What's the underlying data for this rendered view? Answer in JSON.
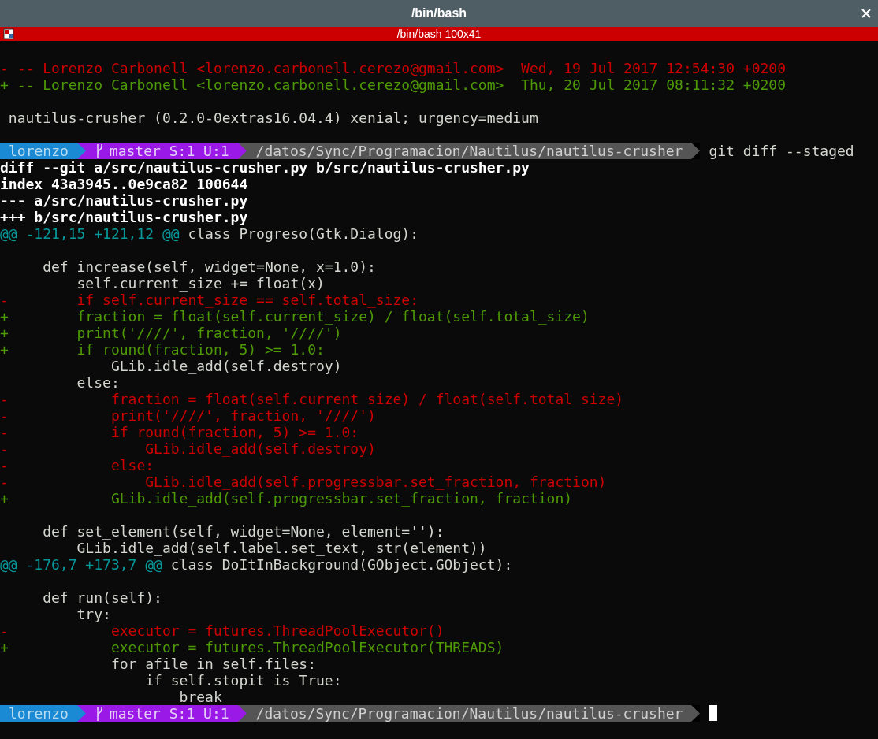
{
  "window": {
    "title": "/bin/bash"
  },
  "tab": {
    "title": "/bin/bash 100x41"
  },
  "terminal": {
    "lines": [
      {
        "kind": "empty"
      },
      {
        "kind": "removed",
        "text": "- -- Lorenzo Carbonell <lorenzo.carbonell.cerezo@gmail.com>  Wed, 19 Jul 2017 12:54:30 +0200"
      },
      {
        "kind": "added",
        "text": "+ -- Lorenzo Carbonell <lorenzo.carbonell.cerezo@gmail.com>  Thu, 20 Jul 2017 08:11:32 +0200"
      },
      {
        "kind": "empty"
      },
      {
        "kind": "plain",
        "text": " nautilus-crusher (0.2.0-0extras16.04.4) xenial; urgency=medium"
      },
      {
        "kind": "empty"
      },
      {
        "kind": "prompt",
        "user": "lorenzo",
        "branch": "master S:1 U:1",
        "path": "/datos/Sync/Programacion/Nautilus/nautilus-crusher",
        "command": "git diff --staged",
        "cursor": false
      },
      {
        "kind": "header",
        "text": "diff --git a/src/nautilus-crusher.py b/src/nautilus-crusher.py"
      },
      {
        "kind": "header",
        "text": "index 43a3945..0e9ca82 100644"
      },
      {
        "kind": "header",
        "text": "--- a/src/nautilus-crusher.py"
      },
      {
        "kind": "header",
        "text": "+++ b/src/nautilus-crusher.py"
      },
      {
        "kind": "hunk",
        "range": "@@ -121,15 +121,12 @@",
        "context": " class Progreso(Gtk.Dialog):"
      },
      {
        "kind": "empty"
      },
      {
        "kind": "plain",
        "text": "     def increase(self, widget=None, x=1.0):"
      },
      {
        "kind": "plain",
        "text": "         self.current_size += float(x)"
      },
      {
        "kind": "removed",
        "text": "-        if self.current_size == self.total_size:"
      },
      {
        "kind": "added",
        "text": "+        fraction = float(self.current_size) / float(self.total_size)"
      },
      {
        "kind": "added",
        "text": "+        print('////', fraction, '////')"
      },
      {
        "kind": "added",
        "text": "+        if round(fraction, 5) >= 1.0:"
      },
      {
        "kind": "plain",
        "text": "             GLib.idle_add(self.destroy)"
      },
      {
        "kind": "plain",
        "text": "         else:"
      },
      {
        "kind": "removed",
        "text": "-            fraction = float(self.current_size) / float(self.total_size)"
      },
      {
        "kind": "removed",
        "text": "-            print('////', fraction, '////')"
      },
      {
        "kind": "removed",
        "text": "-            if round(fraction, 5) >= 1.0:"
      },
      {
        "kind": "removed",
        "text": "-                GLib.idle_add(self.destroy)"
      },
      {
        "kind": "removed",
        "text": "-            else:"
      },
      {
        "kind": "removed",
        "text": "-                GLib.idle_add(self.progressbar.set_fraction, fraction)"
      },
      {
        "kind": "added",
        "text": "+            GLib.idle_add(self.progressbar.set_fraction, fraction)"
      },
      {
        "kind": "empty"
      },
      {
        "kind": "plain",
        "text": "     def set_element(self, widget=None, element=''):"
      },
      {
        "kind": "plain",
        "text": "         GLib.idle_add(self.label.set_text, str(element))"
      },
      {
        "kind": "hunk",
        "range": "@@ -176,7 +173,7 @@",
        "context": " class DoItInBackground(GObject.GObject):"
      },
      {
        "kind": "empty"
      },
      {
        "kind": "plain",
        "text": "     def run(self):"
      },
      {
        "kind": "plain",
        "text": "         try:"
      },
      {
        "kind": "removed",
        "text": "-            executor = futures.ThreadPoolExecutor()"
      },
      {
        "kind": "added",
        "text": "+            executor = futures.ThreadPoolExecutor(THREADS)"
      },
      {
        "kind": "plain",
        "text": "             for afile in self.files:"
      },
      {
        "kind": "plain",
        "text": "                 if self.stopit is True:"
      },
      {
        "kind": "plain",
        "text": "                     break"
      },
      {
        "kind": "prompt",
        "user": "lorenzo",
        "branch": "master S:1 U:1",
        "path": "/datos/Sync/Programacion/Nautilus/nautilus-crusher",
        "cursor": true
      }
    ]
  }
}
